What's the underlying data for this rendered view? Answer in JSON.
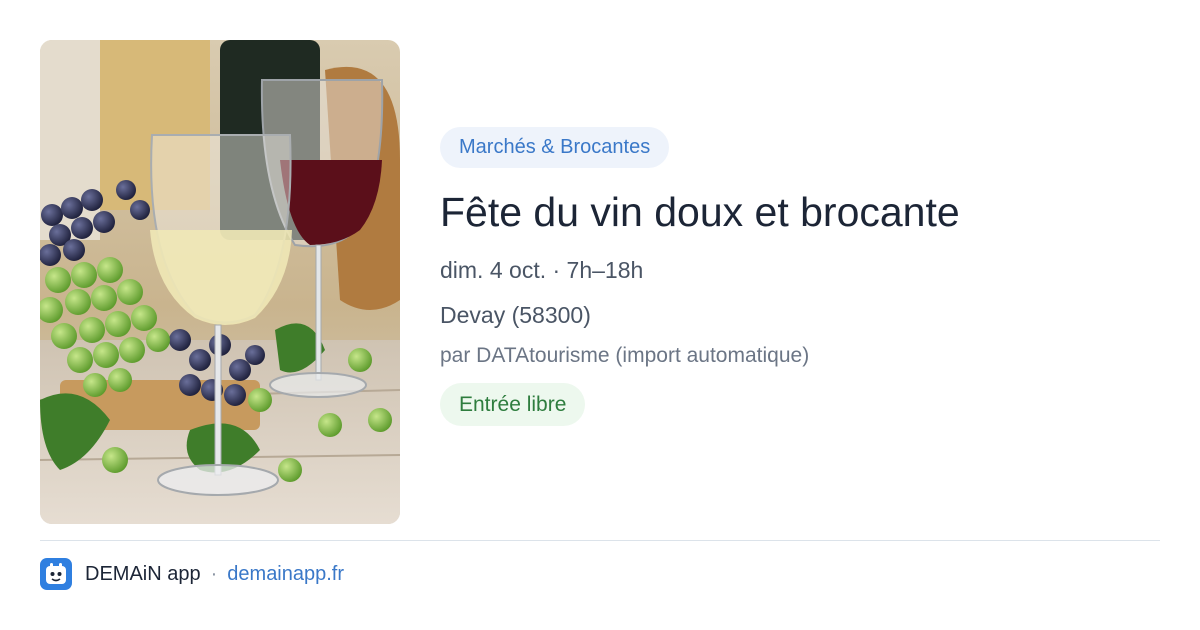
{
  "event": {
    "category": "Marchés & Brocantes",
    "title": "Fête du vin doux et brocante",
    "date_time": "dim. 4 oct. · 7h–18h",
    "location": "Devay (58300)",
    "organizer": "par DATAtourisme (import automatique)",
    "price": "Entrée libre",
    "image_icon": "wine-glasses-grapes-photo"
  },
  "footer": {
    "app_name": "DEMAiN app",
    "separator": "·",
    "domain": "demainapp.fr",
    "logo_icon": "calendar-face-icon"
  },
  "colors": {
    "accent_blue": "#3a78c8",
    "category_bg": "#eef3fb",
    "price_green": "#2e7d3e",
    "price_bg": "#edf8ee",
    "title": "#1c2536",
    "logo_bg": "#2f7fe0"
  }
}
